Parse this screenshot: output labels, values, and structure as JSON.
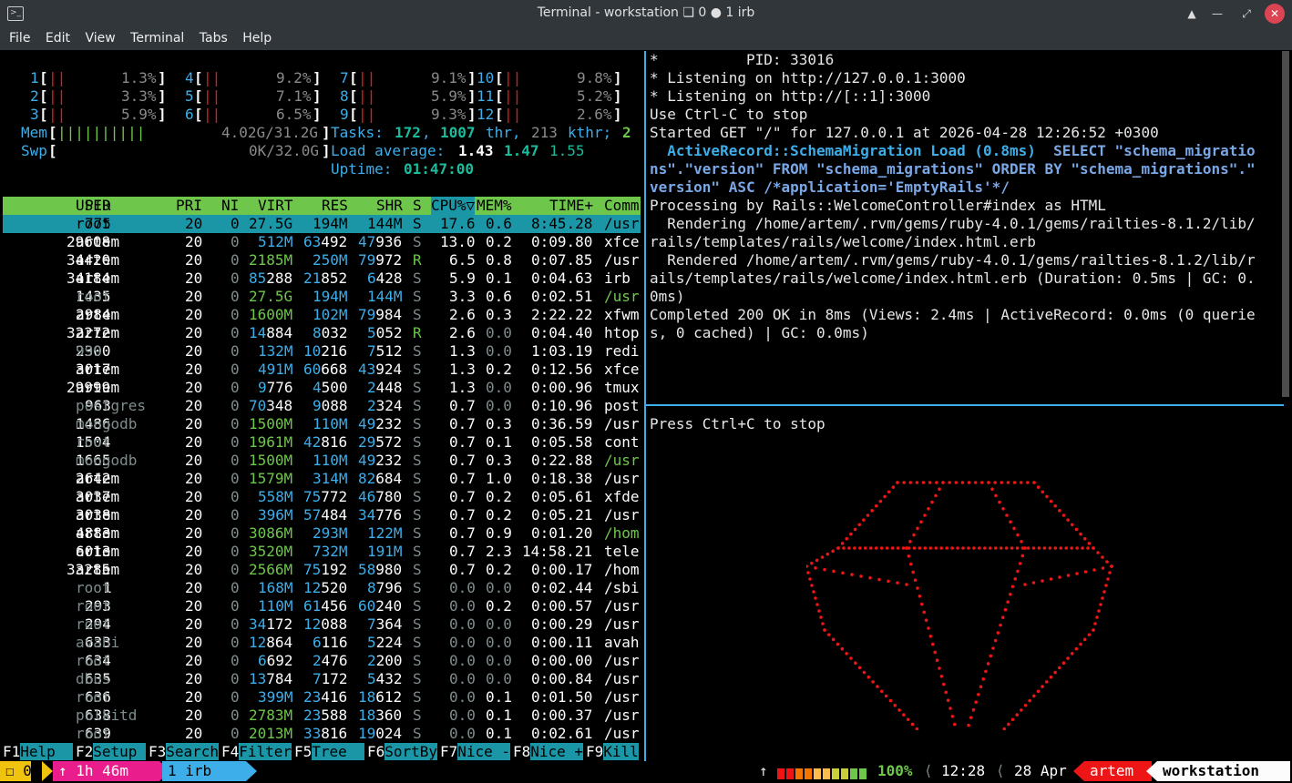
{
  "window": {
    "title": "Terminal - workstation ❑ 0 ● 1 irb",
    "icon": "terminal-icon",
    "buttons": [
      "keep-above-icon",
      "minimize-icon",
      "maximize-icon",
      "close-icon"
    ]
  },
  "menu": [
    "File",
    "Edit",
    "View",
    "Terminal",
    "Tabs",
    "Help"
  ],
  "htop": {
    "cpu": [
      {
        "n": "1",
        "bar": "||",
        "pct": "1.3%"
      },
      {
        "n": "2",
        "bar": "||",
        "pct": "3.3%"
      },
      {
        "n": "3",
        "bar": "||",
        "pct": "5.9%"
      },
      {
        "n": "4",
        "bar": "||",
        "pct": "9.2%"
      },
      {
        "n": "5",
        "bar": "||",
        "pct": "7.1%"
      },
      {
        "n": "6",
        "bar": "||",
        "pct": "6.5%"
      },
      {
        "n": "7",
        "bar": "||",
        "pct": "9.1%"
      },
      {
        "n": "8",
        "bar": "||",
        "pct": "5.9%"
      },
      {
        "n": "9",
        "bar": "||",
        "pct": "9.3%"
      },
      {
        "n": "10",
        "bar": "||",
        "pct": "9.8%"
      },
      {
        "n": "11",
        "bar": "||",
        "pct": "5.2%"
      },
      {
        "n": "12",
        "bar": "||",
        "pct": "2.6%"
      }
    ],
    "mem": {
      "label": "Mem",
      "bar": "||||||||||",
      "value": "4.02G/31.2G"
    },
    "swp": {
      "label": "Swp",
      "bar": "",
      "value": "0K/32.0G"
    },
    "tasks": {
      "label": "Tasks:",
      "tasks": "172",
      "thr": "1007",
      "thr_label": "thr,",
      "kthr": "213",
      "kthr_label": "kthr;",
      "running": "2"
    },
    "load": {
      "label": "Load average:",
      "l1": "1.43",
      "l5": "1.47",
      "l15": "1.55"
    },
    "uptime": {
      "label": "Uptime:",
      "value": "01:47:00"
    },
    "header": [
      "PID",
      "USER",
      "PRI",
      "NI",
      "VIRT",
      "RES",
      "SHR",
      "S",
      "CPU%▽",
      "MEM%",
      "TIME+",
      "Comm"
    ],
    "rows": [
      [
        "775",
        "root",
        "20",
        "0",
        "27.5G",
        "194M",
        "144M",
        "S",
        "17.6",
        "0.6",
        "8:45.28",
        "/usr"
      ],
      [
        "29608",
        "artem",
        "20",
        "0",
        "512M",
        "63492",
        "47936",
        "S",
        "13.0",
        "0.2",
        "0:09.80",
        "xfce"
      ],
      [
        "34420",
        "artem",
        "20",
        "0",
        "2185M",
        "250M",
        "79972",
        "R",
        "6.5",
        "0.8",
        "0:07.85",
        "/usr"
      ],
      [
        "34184",
        "artem",
        "20",
        "0",
        "85288",
        "21852",
        "6428",
        "S",
        "5.9",
        "0.1",
        "0:04.63",
        "irb"
      ],
      [
        "1435",
        "root",
        "20",
        "0",
        "27.5G",
        "194M",
        "144M",
        "S",
        "3.3",
        "0.6",
        "0:02.51",
        "/usr"
      ],
      [
        "2984",
        "artem",
        "20",
        "0",
        "1600M",
        "102M",
        "79984",
        "S",
        "2.6",
        "0.3",
        "2:22.22",
        "xfwm"
      ],
      [
        "32272",
        "artem",
        "20",
        "0",
        "14884",
        "8032",
        "5052",
        "R",
        "2.6",
        "0.0",
        "0:04.40",
        "htop"
      ],
      [
        "2300",
        "999",
        "20",
        "0",
        "132M",
        "10216",
        "7512",
        "S",
        "1.3",
        "0.0",
        "1:03.19",
        "redi"
      ],
      [
        "3017",
        "artem",
        "20",
        "0",
        "491M",
        "60668",
        "43924",
        "S",
        "1.3",
        "0.2",
        "0:12.56",
        "xfce"
      ],
      [
        "29999",
        "artem",
        "20",
        "0",
        "9776",
        "4500",
        "2448",
        "S",
        "1.3",
        "0.0",
        "0:00.96",
        "tmux"
      ],
      [
        "963",
        "postgres",
        "20",
        "0",
        "70348",
        "9088",
        "2324",
        "S",
        "0.7",
        "0.0",
        "0:10.96",
        "post"
      ],
      [
        "1486",
        "mongodb",
        "20",
        "0",
        "1500M",
        "110M",
        "49232",
        "S",
        "0.7",
        "0.3",
        "0:36.59",
        "/usr"
      ],
      [
        "1504",
        "root",
        "20",
        "0",
        "1961M",
        "42816",
        "29572",
        "S",
        "0.7",
        "0.1",
        "0:05.58",
        "cont"
      ],
      [
        "1665",
        "mongodb",
        "20",
        "0",
        "1500M",
        "110M",
        "49232",
        "S",
        "0.7",
        "0.3",
        "0:22.88",
        "/usr"
      ],
      [
        "2642",
        "artem",
        "20",
        "0",
        "1579M",
        "314M",
        "82684",
        "S",
        "0.7",
        "1.0",
        "0:18.38",
        "/usr"
      ],
      [
        "3037",
        "artem",
        "20",
        "0",
        "558M",
        "75772",
        "46780",
        "S",
        "0.7",
        "0.2",
        "0:05.61",
        "xfde"
      ],
      [
        "3038",
        "artem",
        "20",
        "0",
        "396M",
        "57484",
        "34776",
        "S",
        "0.7",
        "0.2",
        "0:05.21",
        "/usr"
      ],
      [
        "4883",
        "artem",
        "20",
        "0",
        "3086M",
        "293M",
        "122M",
        "S",
        "0.7",
        "0.9",
        "0:01.20",
        "/hom"
      ],
      [
        "6013",
        "artem",
        "20",
        "0",
        "3520M",
        "732M",
        "191M",
        "S",
        "0.7",
        "2.3",
        "14:58.21",
        "tele"
      ],
      [
        "33285",
        "artem",
        "20",
        "0",
        "2566M",
        "75192",
        "58980",
        "S",
        "0.7",
        "0.2",
        "0:00.17",
        "/hom"
      ],
      [
        "1",
        "root",
        "20",
        "0",
        "168M",
        "12520",
        "8796",
        "S",
        "0.0",
        "0.0",
        "0:02.44",
        "/sbi"
      ],
      [
        "293",
        "root",
        "20",
        "0",
        "110M",
        "61456",
        "60240",
        "S",
        "0.0",
        "0.2",
        "0:00.57",
        "/usr"
      ],
      [
        "294",
        "root",
        "20",
        "0",
        "34172",
        "12088",
        "7364",
        "S",
        "0.0",
        "0.0",
        "0:00.29",
        "/usr"
      ],
      [
        "633",
        "avahi",
        "20",
        "0",
        "12864",
        "6116",
        "5224",
        "S",
        "0.0",
        "0.0",
        "0:00.11",
        "avah"
      ],
      [
        "634",
        "root",
        "20",
        "0",
        "6692",
        "2476",
        "2200",
        "S",
        "0.0",
        "0.0",
        "0:00.00",
        "/usr"
      ],
      [
        "635",
        "dbus",
        "20",
        "0",
        "13784",
        "7172",
        "5432",
        "S",
        "0.0",
        "0.0",
        "0:00.84",
        "/usr"
      ],
      [
        "636",
        "root",
        "20",
        "0",
        "399M",
        "23416",
        "18612",
        "S",
        "0.0",
        "0.1",
        "0:01.50",
        "/usr"
      ],
      [
        "638",
        "polkitd",
        "20",
        "0",
        "2783M",
        "23588",
        "18360",
        "S",
        "0.0",
        "0.1",
        "0:00.37",
        "/usr"
      ],
      [
        "639",
        "root",
        "20",
        "0",
        "2013M",
        "33816",
        "19024",
        "S",
        "0.0",
        "0.1",
        "0:02.61",
        "/usr"
      ]
    ],
    "fkeys": [
      {
        "k": "F1",
        "l": "Help  "
      },
      {
        "k": "F2",
        "l": "Setup "
      },
      {
        "k": "F3",
        "l": "Search"
      },
      {
        "k": "F4",
        "l": "Filter"
      },
      {
        "k": "F5",
        "l": "Tree  "
      },
      {
        "k": "F6",
        "l": "SortBy"
      },
      {
        "k": "F7",
        "l": "Nice -"
      },
      {
        "k": "F8",
        "l": "Nice +"
      },
      {
        "k": "F9",
        "l": "Kill"
      }
    ]
  },
  "rails_log": [
    "*          PID: 33016",
    "* Listening on http://127.0.0.1:3000",
    "* Listening on http://[::1]:3000",
    "Use Ctrl-C to stop",
    "Started GET \"/\" for 127.0.0.1 at 2026-04-28 12:26:52 +0300",
    "  ActiveRecord::SchemaMigration Load (0.8ms)  SELECT \"schema_migratio",
    "ns\".\"version\" FROM \"schema_migrations\" ORDER BY \"schema_migrations\".\"",
    "version\" ASC /*application='EmptyRails'*/",
    "Processing by Rails::WelcomeController#index as HTML",
    "  Rendering /home/artem/.rvm/gems/ruby-4.0.1/gems/railties-8.1.2/lib/",
    "rails/templates/rails/welcome/index.html.erb",
    "  Rendered /home/artem/.rvm/gems/ruby-4.0.1/gems/railties-8.1.2/lib/r",
    "ails/templates/rails/welcome/index.html.erb (Duration: 0.5ms | GC: 0.",
    "0ms)",
    "Completed 200 OK in 8ms (Views: 2.4ms | ActiveRecord: 0.0ms (0 querie",
    "s, 0 cached) | GC: 0.0ms)"
  ],
  "bottom_pane": {
    "text": "Press Ctrl+C to stop"
  },
  "tmux": {
    "session": "0",
    "uptime": "↑ 1h 46m",
    "window": "1 irb",
    "up_arrow": "↑",
    "battery": "100%",
    "battery_level": 1.0,
    "time": "12:28",
    "date": "28 Apr",
    "user": "artem",
    "host": "workstation",
    "bar_colors": [
      "#ed1515",
      "#ed1515",
      "#f67400",
      "#f67400",
      "#fdbc4b",
      "#fdbc4b",
      "#c9ce3b",
      "#c9ce3b",
      "#6ec74b",
      "#6ec74b"
    ]
  }
}
